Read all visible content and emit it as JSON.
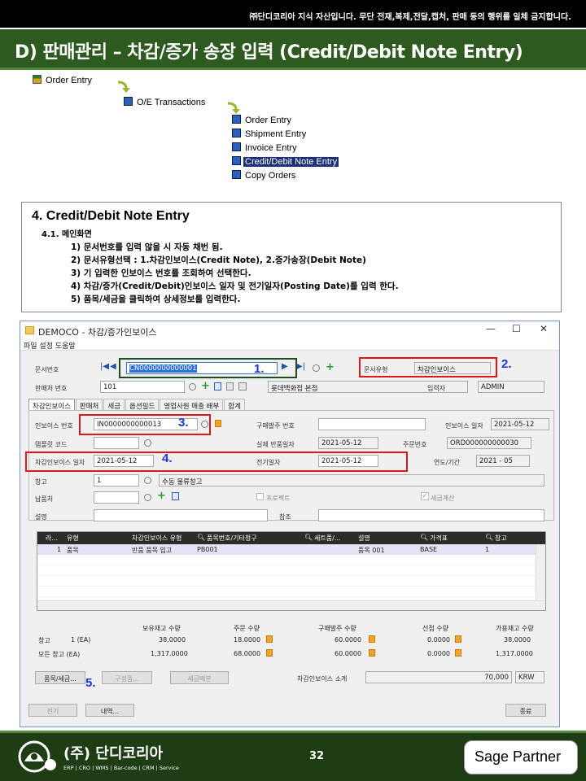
{
  "header": {
    "notice": "㈜단디코리아 지식 자산입니다. 무단 전재,복제,전달,캡처,  판매 등의 행위를 일체 금지합니다.",
    "title": "D) 판매관리 – 차감/증가 송장 입력 (Credit/Debit Note Entry)"
  },
  "tree": {
    "root": "Order Entry",
    "level1": "O/E Transactions",
    "items": [
      "Order Entry",
      "Shipment Entry",
      "Invoice Entry",
      "Credit/Debit Note Entry",
      "Copy Orders"
    ],
    "selected_index": 3
  },
  "description": {
    "heading": "4. Credit/Debit Note Entry",
    "subheading": "4.1. 메인화면",
    "lines": [
      "1) 문서번호를 입력 않을 시 자동 채번 됨.",
      "2) 문서유형선택 : 1.차감인보이스(Credit  Note), 2.증가송장(Debit Note)",
      "3) 기 입력한 인보이스 번호를 조회하여 선택한다.",
      "4) 차감/증가(Credit/Debit)인보이스  일자 및 전기일자(Posting Date)를 입력 한다.",
      "5) 품목/세금을 클릭하여 상세정보를 입력한다."
    ]
  },
  "window": {
    "title": "DEMOCO - 차감/증가인보이스",
    "menu": "파일  설정  도움말",
    "doc_no_label": "문서번호",
    "doc_no_value": "CN0000000000001",
    "doc_type_label": "문서유형",
    "doc_type_value": "차감인보이스",
    "customer_label": "판매처 번호",
    "customer_value": "101",
    "customer_name": "롯데백화점 본점",
    "entered_by_label": "입력자",
    "entered_by_value": "ADMIN",
    "tabs": [
      "차감인보이스",
      "판매처",
      "세금",
      "옵션필드",
      "영업사원 매출 배부",
      "합계"
    ],
    "invoice_no_label": "인보이스 번호",
    "invoice_no_value": "IN0000000000013",
    "po_label": "구매발주 번호",
    "po_value": "",
    "invoice_date_label": "인보이스 일자",
    "invoice_date_value": "2021-05-12",
    "template_label": "템플릿 코드",
    "template_value": "",
    "actual_return_label": "실제 반품일자",
    "actual_return_value": "2021-05-12",
    "order_no_label": "주문번호",
    "order_no_value": "ORD000000000030",
    "cn_date_label": "차감인보이스 일자",
    "cn_date_value": "2021-05-12",
    "posting_date_label": "전기일자",
    "posting_date_value": "2021-05-12",
    "year_period_label": "연도/기간",
    "year_period_value": "2021 - 05",
    "warehouse_label": "창고",
    "warehouse_value": "1",
    "warehouse_name": "수동 물류창고",
    "shipvia_label": "납품처",
    "shipvia_value": "",
    "project_label": "프로젝트",
    "tax_calc_label": "세금계산",
    "desc_label": "설명",
    "ref_label": "참조",
    "grid": {
      "headers": [
        "라...",
        "유형",
        "차감인보이스 유형",
        "품목번호/기타청구",
        "세트품/...",
        "설명",
        "가격표",
        "창고"
      ],
      "rows": [
        [
          "1",
          "품목",
          "반품 품목 입고",
          "PB001",
          "",
          "품목 001",
          "BASE",
          "1"
        ]
      ]
    },
    "summary": {
      "headers": [
        "보유재고 수량",
        "주문 수량",
        "구매발주 수량",
        "선점 수량",
        "가용재고 수량"
      ],
      "rows": [
        {
          "label": "창고",
          "unit": "1 (EA)",
          "values": [
            "38.0000",
            "18.0000",
            "60.0000",
            "0.0000",
            "38.0000"
          ]
        },
        {
          "label": "모든 창고 (EA)",
          "unit": "",
          "values": [
            "1,317.0000",
            "68.0000",
            "60.0000",
            "0.0000",
            "1,317.0000"
          ]
        }
      ]
    },
    "btn_items": "품목/세금...",
    "btn_components": "구성품...",
    "btn_tax": "세금배분",
    "total_label": "차감인보이스 소계",
    "total_value": "70,000",
    "currency": "KRW",
    "btn_post": "전기",
    "btn_history": "내역...",
    "btn_close": "종료"
  },
  "callouts": [
    "1.",
    "2.",
    "3.",
    "4.",
    "5."
  ],
  "footer": {
    "company": "(주) 단디코리아",
    "tagline": "ERP | CRO | WMS | Bar-code | CRM | Service",
    "page": "32",
    "partner": "Sage Partner"
  }
}
